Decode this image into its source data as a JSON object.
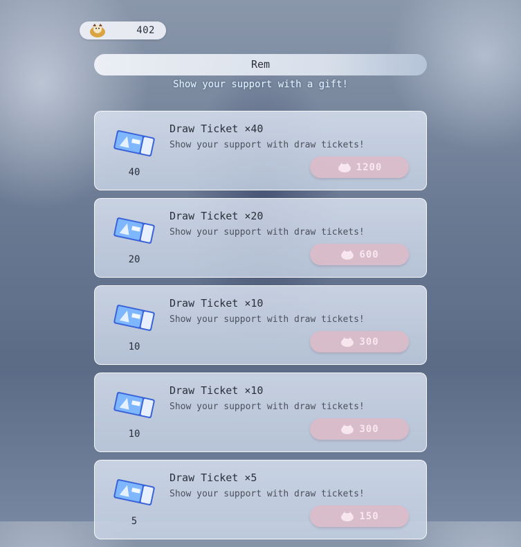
{
  "currency": {
    "amount": "402",
    "icon": "mascot-coin-icon"
  },
  "header": {
    "title": "Rem",
    "subtitle": "Show your support with a gift!"
  },
  "gifts": [
    {
      "title": "Draw Ticket ×40",
      "description": "Show your support with draw tickets!",
      "quantity": "40",
      "price": "1200",
      "enabled": false
    },
    {
      "title": "Draw Ticket ×20",
      "description": "Show your support with draw tickets!",
      "quantity": "20",
      "price": "600",
      "enabled": false
    },
    {
      "title": "Draw Ticket ×10",
      "description": "Show your support with draw tickets!",
      "quantity": "10",
      "price": "300",
      "enabled": false
    },
    {
      "title": "Draw Ticket ×10",
      "description": "Show your support with draw tickets!",
      "quantity": "10",
      "price": "300",
      "enabled": false
    },
    {
      "title": "Draw Ticket ×5",
      "description": "Show your support with draw tickets!",
      "quantity": "5",
      "price": "150",
      "enabled": false
    }
  ],
  "icons": {
    "ticket": "draw-ticket-icon",
    "price": "currency-icon"
  },
  "colors": {
    "accent_button": "#e2b8c4",
    "card_bg": "#d5deec",
    "subtitle_text": "#e8f6ff"
  }
}
